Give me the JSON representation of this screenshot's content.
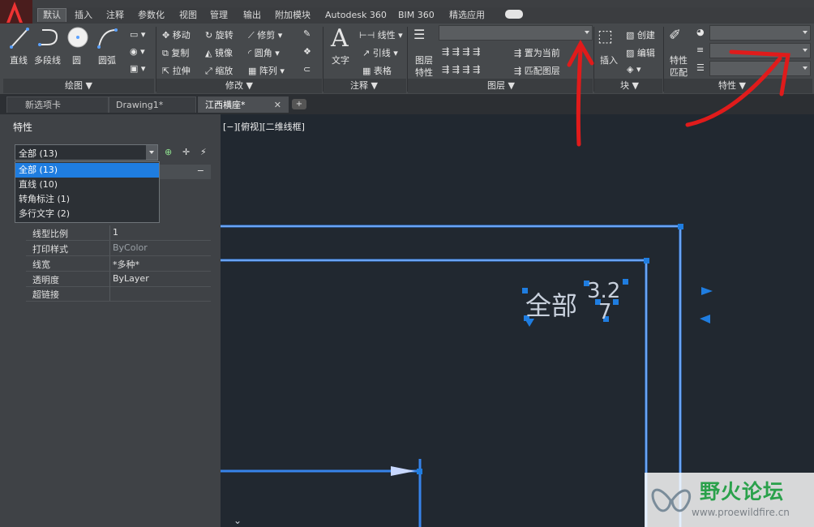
{
  "ribbon_tabs": [
    "默认",
    "插入",
    "注释",
    "参数化",
    "视图",
    "管理",
    "输出",
    "附加模块",
    "Autodesk 360",
    "BIM 360",
    "精选应用"
  ],
  "panels": {
    "draw": {
      "title": "绘图 ▼",
      "items": [
        "直线",
        "多段线",
        "圆",
        "圆弧"
      ]
    },
    "modify": {
      "title": "修改 ▼",
      "items": [
        "移动",
        "旋转",
        "修剪",
        "复制",
        "镜像",
        "圆角",
        "拉伸",
        "缩放",
        "阵列"
      ]
    },
    "annotate": {
      "title": "注释 ▼",
      "items": [
        "文字",
        "线性",
        "引线",
        "表格"
      ]
    },
    "layers": {
      "title": "图层 ▼",
      "items": [
        "图层",
        "特性",
        "置为当前",
        "匹配图层"
      ]
    },
    "block": {
      "title": "块 ▼",
      "items": [
        "插入",
        "创建",
        "编辑"
      ]
    },
    "properties": {
      "title": "特性 ▼",
      "items": [
        "特性",
        "匹配"
      ]
    }
  },
  "doc_tabs": [
    "新选项卡",
    "Drawing1*",
    "江西横座*"
  ],
  "palette": {
    "title": "特性",
    "selection": "全部 (13)",
    "dropdown": [
      "全部 (13)",
      "直线 (10)",
      "转角标注 (1)",
      "多行文字 (2)"
    ],
    "rows": [
      {
        "k": "线型比例",
        "v": "1"
      },
      {
        "k": "打印样式",
        "v": "ByColor"
      },
      {
        "k": "线宽",
        "v": "*多种*"
      },
      {
        "k": "透明度",
        "v": "ByLayer"
      },
      {
        "k": "超链接",
        "v": ""
      }
    ]
  },
  "viewport": {
    "label": "[−][俯视][二维线框]",
    "text_a": "全部",
    "text_b": "3.2",
    "text_c": "7"
  },
  "watermark": {
    "title": "野火论坛",
    "url": "www.proewildfire.cn"
  },
  "colors": {
    "accent": "#1f7de0",
    "annotation": "#e01b1b",
    "selection": "#3a8dff"
  }
}
